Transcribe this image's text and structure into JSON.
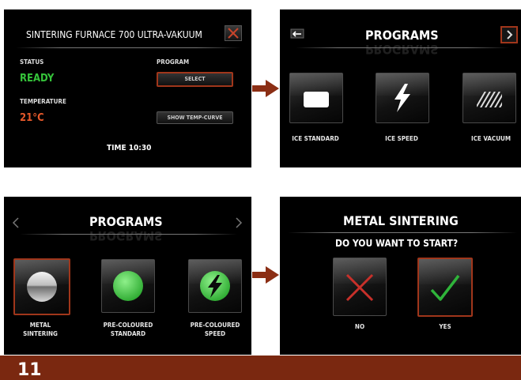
{
  "screen1": {
    "title": "SINTERING FURNACE 700 ULTRA-VAKUUM",
    "status_label": "STATUS",
    "status_value": "READY",
    "program_label": "PROGRAM",
    "select_button": "SELECT",
    "temperature_label": "TEMPERATURE",
    "temperature_value": "21°C",
    "temp_curve_button": "SHOW TEMP-CURVE",
    "time": "TIME 10:30"
  },
  "screen2": {
    "title": "PROGRAMS",
    "programs": [
      {
        "label": "ICE STANDARD",
        "icon": "white-square-icon"
      },
      {
        "label": "ICE SPEED",
        "icon": "lightning-icon"
      },
      {
        "label": "ICE VACUUM",
        "icon": "hatched-square-icon"
      }
    ]
  },
  "screen3": {
    "title": "PROGRAMS",
    "programs": [
      {
        "label": "METAL SINTERING",
        "icon": "silver-sphere-icon"
      },
      {
        "label": "PRE-COLOURED STANDARD",
        "icon": "green-circle-icon"
      },
      {
        "label": "PRE-COLOURED SPEED",
        "icon": "green-lightning-icon"
      }
    ]
  },
  "screen4": {
    "title": "METAL SINTERING",
    "question": "DO YOU WANT TO START?",
    "no_label": "NO",
    "yes_label": "YES"
  },
  "footer": {
    "page_number": "11"
  },
  "colors": {
    "accent": "#a0361b",
    "ready": "#35c33a",
    "temperature": "#e5582a",
    "footer": "#7a2810"
  }
}
